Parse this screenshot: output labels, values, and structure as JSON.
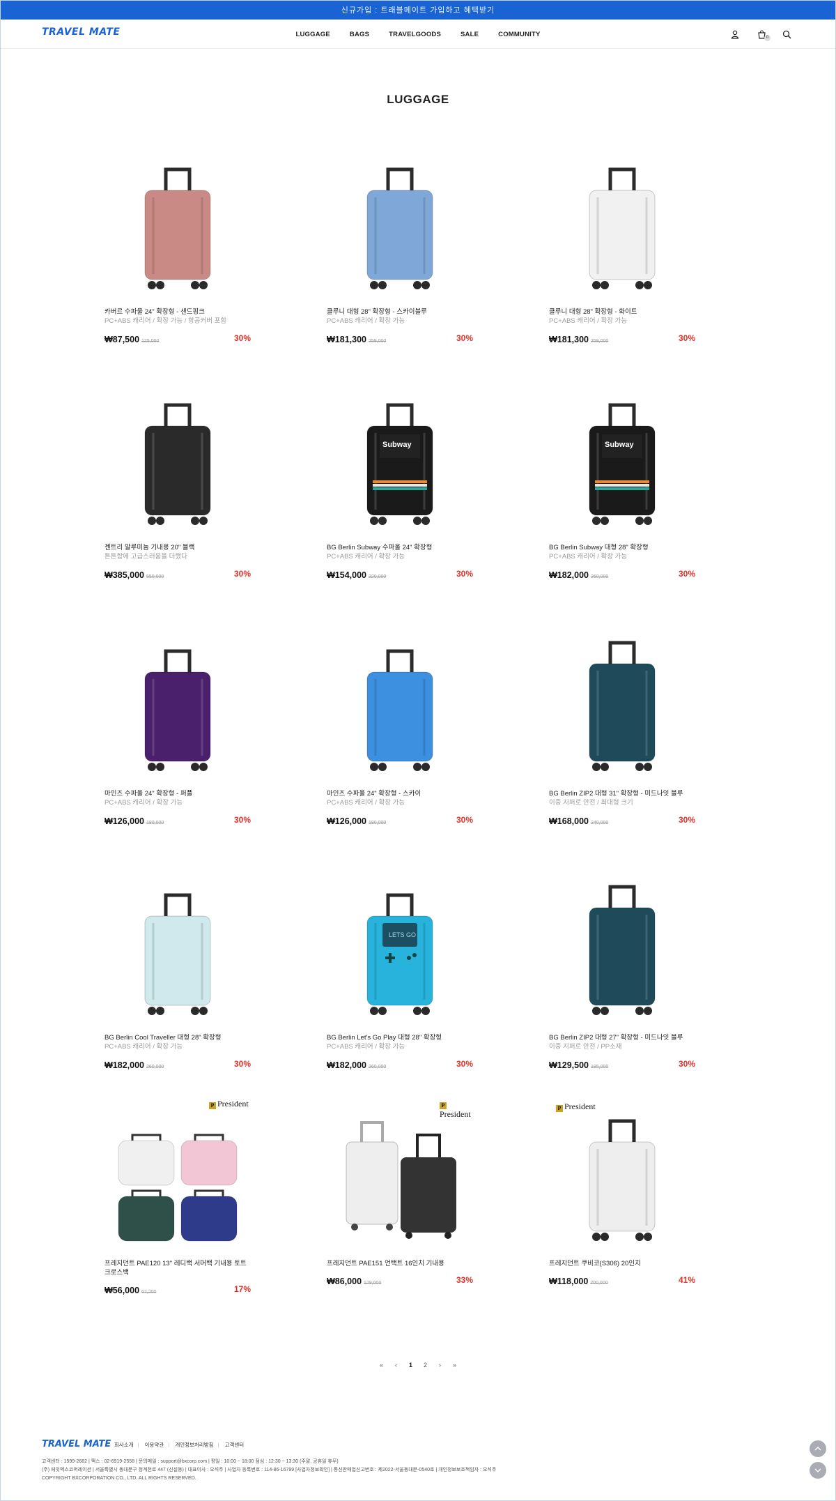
{
  "top_banner": {
    "text": "신규가입 : 트래블메이트 가입하고 혜택받기"
  },
  "header": {
    "logo": "TRAVEL MATE",
    "nav": [
      "LUGGAGE",
      "BAGS",
      "TRAVELGOODS",
      "SALE",
      "COMMUNITY"
    ],
    "icons": [
      "user-icon",
      "cart-icon",
      "search-icon"
    ],
    "cart_count": "0"
  },
  "page_title": "LUGGAGE",
  "products": [
    {
      "name": "카버르 수파울 24\" 확장형 - 샌드핑크",
      "desc": "PC+ABS 캐리어 / 확장 가능 / 항공커버 포함",
      "price": "₩87,500",
      "original": "125,000",
      "discount": "30%",
      "color": "#c98a86"
    },
    {
      "name": "클루니 대형 28\" 확장형 - 스카이블루",
      "desc": "PC+ABS 캐리어 / 확장 가능",
      "price": "₩181,300",
      "original": "259,000",
      "discount": "30%",
      "color": "#7fa8d8"
    },
    {
      "name": "클루니 대형 28\" 확장형 - 화이트",
      "desc": "PC+ABS 캐리어 / 확장 가능",
      "price": "₩181,300",
      "original": "259,000",
      "discount": "30%",
      "color": "#f1f1f1"
    },
    {
      "name": "젠트리 알루미늄 기내용 20\" 블랙",
      "desc": "튼튼함에 고급스러움을 더했다",
      "price": "₩385,000",
      "original": "550,000",
      "discount": "30%",
      "color": "#2a2a2a"
    },
    {
      "name": "BG Berlin Subway 수파울 24\" 확장형",
      "desc": "PC+ABS 캐리어 / 확장 가능",
      "price": "₩154,000",
      "original": "220,000",
      "discount": "30%",
      "color": "#1a1a1a"
    },
    {
      "name": "BG Berlin Subway 대형 28\" 확장형",
      "desc": "PC+ABS 캐리어 / 확장 가능",
      "price": "₩182,000",
      "original": "260,000",
      "discount": "30%",
      "color": "#1a1a1a"
    },
    {
      "name": "마인즈 수파울 24\" 확장형 - 퍼플",
      "desc": "PC+ABS 캐리어 / 확장 가능",
      "price": "₩126,000",
      "original": "180,000",
      "discount": "30%",
      "color": "#4a1f6b"
    },
    {
      "name": "마인즈 수파울 24\" 확장형 - 스카이",
      "desc": "PC+ABS 캐리어 / 확장 가능",
      "price": "₩126,000",
      "original": "180,000",
      "discount": "30%",
      "color": "#3d8fe0"
    },
    {
      "name": "BG Berlin ZIP2 대형 31\" 확장형 - 미드나잇 블루",
      "desc": "이중 지퍼로 안전 / 최대형 크기",
      "price": "₩168,000",
      "original": "240,000",
      "discount": "30%",
      "color": "#1e4a5a"
    },
    {
      "name": "BG Berlin Cool Traveller 대형 28\" 확장형",
      "desc": "PC+ABS 캐리어 / 확장 가능",
      "price": "₩182,000",
      "original": "260,000",
      "discount": "30%",
      "color": "#cfe9ec"
    },
    {
      "name": "BG Berlin Let's Go Play 대형 28\" 확장형",
      "desc": "PC+ABS 캐리어 / 확장 가능",
      "price": "₩182,000",
      "original": "260,000",
      "discount": "30%",
      "color": "#27b3dc"
    },
    {
      "name": "BG Berlin ZIP2 대형 27\" 확장형 - 미드나잇 블루",
      "desc": "이중 지퍼로 안전 / PP소재",
      "price": "₩129,500",
      "original": "185,000",
      "discount": "30%",
      "color": "#1e4a5a"
    },
    {
      "name": "프레지던트 PAE120 13\" 레디백 서머백 기내용 토트 크로스백",
      "desc": "",
      "price": "₩56,000",
      "original": "67,200",
      "discount": "17%",
      "color": "#888888"
    },
    {
      "name": "프레지던트 PAE151 언택트 16인치 기내용",
      "desc": "",
      "price": "₩86,000",
      "original": "129,000",
      "discount": "33%",
      "color": "#333333"
    },
    {
      "name": "프레지던트 쿠비코(S306) 20인치",
      "desc": "",
      "price": "₩118,000",
      "original": "200,000",
      "discount": "41%",
      "color": "#eeeeee"
    }
  ],
  "brand_president": "President",
  "cool_traveller_art": {
    "subway": "Subway",
    "lets_go": "LETS GO"
  },
  "pagination": [
    "«",
    "‹",
    "1",
    "2",
    "›",
    "»"
  ],
  "pagination_active": "1",
  "footer": {
    "logo": "TRAVEL MATE",
    "links": [
      "회사소개",
      "이용약관",
      "개인정보처리방침",
      "고객센터"
    ],
    "line1": "고객센터 : 1599-2682  |  팩스 : 02-6919-2558  |  문의메일 : support@bxcorp.com  |  평일 : 10:00 ~ 18:00 점심 : 12:30 ~ 13:30 (주말, 공휴일 휴무)",
    "line2": "(주) 에잇엑스코퍼레이션  |  서울특별시 동대문구 청계천로 447 (신설동)  |  대표이사 : 오석주  |  사업자 등록번호 : 114-86-16799 [사업자정보확인]  |  통신판매업신고번호 : 제2022-서울동대문-0540호  |  개인정보보호책임자 : 오석주",
    "line3": "COPYRIGHT BXCORPORATION CO., LTD. ALL RIGHTS RESERVED."
  }
}
